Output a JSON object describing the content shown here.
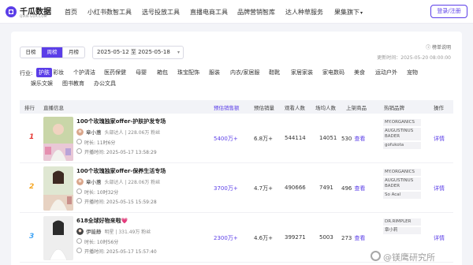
{
  "brand": {
    "title": "千瓜数据",
    "subtitle": "QIAN-GUA.COM",
    "colors": {
      "accent": "#5b3ee8",
      "rank1": "#e53935",
      "rank2": "#f5a623",
      "rank3": "#42a5f5"
    }
  },
  "nav": {
    "items": [
      "首页",
      "小红书数智工具",
      "选号投放工具",
      "直播电商工具",
      "品牌营销智库",
      "达人种草服务",
      "果集旗下"
    ],
    "caret": "▾",
    "login_label": "登录/注册"
  },
  "toolbar": {
    "period_tabs": [
      "日榜",
      "周榜",
      "月榜"
    ],
    "active_period": "周榜",
    "date_range": "2025-05-12 至 2025-05-18",
    "date_chevron": "chevron-down-icon",
    "rules_link": "榜单说明",
    "update_time": "更新时间：2025-05-20 08:00:00"
  },
  "industry": {
    "label": "行业:",
    "row1": [
      "护肤",
      "彩妆",
      "个护清洁",
      "医药保健",
      "母婴",
      "箱包",
      "珠宝配饰",
      "服装",
      "内衣/家居服",
      "鞋靴",
      "家居家装",
      "家电数码",
      "美食",
      "运动户外",
      "宠物"
    ],
    "row2": [
      "娱乐文娱",
      "图书教育",
      "办公文具"
    ],
    "active": "护肤"
  },
  "table": {
    "headers": [
      "排行",
      "直播信息",
      "预估销售额",
      "预估销量",
      "观看人数",
      "场均人数",
      "上架商品",
      "热销品牌",
      "操作"
    ],
    "rows": [
      {
        "rank": "1",
        "title": "100个玫瑰独家offer-护肤护发专场",
        "host": "章小蕙",
        "host_meta": "头部达人 | 228.06万 粉丝",
        "duration": "时长: 11时6分",
        "start": "开播时间: 2025-05-17 13:58:29",
        "sales_amount": "5400万+",
        "sales_volume": "6.8万+",
        "viewers": "544114",
        "avg_viewers": "14051",
        "products": "530",
        "view_link": "查看",
        "brands": [
          "MY.ORGANICS",
          "AUGUSTINUS BADER",
          "gofukota"
        ],
        "action": "详情"
      },
      {
        "rank": "2",
        "title": "100个玫瑰独家offer-保养生活专场",
        "host": "章小蕙",
        "host_meta": "头部达人 | 228.06万 粉丝",
        "duration": "时长: 10时32分",
        "start": "开播时间: 2025-05-15 15:59:28",
        "sales_amount": "3700万+",
        "sales_volume": "4.7万+",
        "viewers": "490666",
        "avg_viewers": "7491",
        "products": "496",
        "view_link": "查看",
        "brands": [
          "MY.ORGANICS",
          "AUGUSTINUS BADER",
          "So Acal"
        ],
        "action": "详情"
      },
      {
        "rank": "3",
        "title": "618全球好物来啦💗",
        "host": "伊能静",
        "host_meta": "明星 | 331.49万 粉丝",
        "duration": "时长: 10时56分",
        "start": "开播时间: 2025-05-17 15:57:40",
        "sales_amount": "2300万+",
        "sales_volume": "4.6万+",
        "viewers": "399271",
        "avg_viewers": "5003",
        "products": "273",
        "view_link": "查看",
        "brands": [
          "DR.RIMPLER",
          "章小莉"
        ],
        "action": "详情"
      }
    ]
  },
  "watermark": "@镁鹰研究所"
}
